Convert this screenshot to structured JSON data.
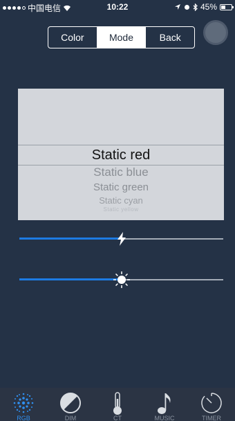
{
  "status_bar": {
    "carrier": "中国电信",
    "time": "10:22",
    "battery_text": "45%",
    "battery_level": 0.45
  },
  "mode_control": {
    "segments": [
      {
        "label": "Color",
        "active": false
      },
      {
        "label": "Mode",
        "active": true
      },
      {
        "label": "Back",
        "active": false
      }
    ]
  },
  "picker": {
    "items": [
      "Static red",
      "Static blue",
      "Static green",
      "Static cyan",
      "Static yellow"
    ],
    "selected_index": 0
  },
  "sliders": [
    {
      "name": "speed",
      "icon": "lightning-icon",
      "level": 0.5
    },
    {
      "name": "brightness",
      "icon": "sun-icon",
      "level": 0.5
    }
  ],
  "tabbar": {
    "tabs": [
      {
        "label": "RGB",
        "icon": "rgb-dots-icon",
        "active": true
      },
      {
        "label": "DIM",
        "icon": "half-circle-icon",
        "active": false
      },
      {
        "label": "CT",
        "icon": "thermometer-icon",
        "active": false
      },
      {
        "label": "MUSIC",
        "icon": "music-note-icon",
        "active": false
      },
      {
        "label": "TIMER",
        "icon": "timer-icon",
        "active": false
      }
    ]
  },
  "colors": {
    "background": "#243246",
    "accent": "#1d7be3",
    "tab_active": "#2f8ff0",
    "picker_bg": "#d3d6db"
  }
}
